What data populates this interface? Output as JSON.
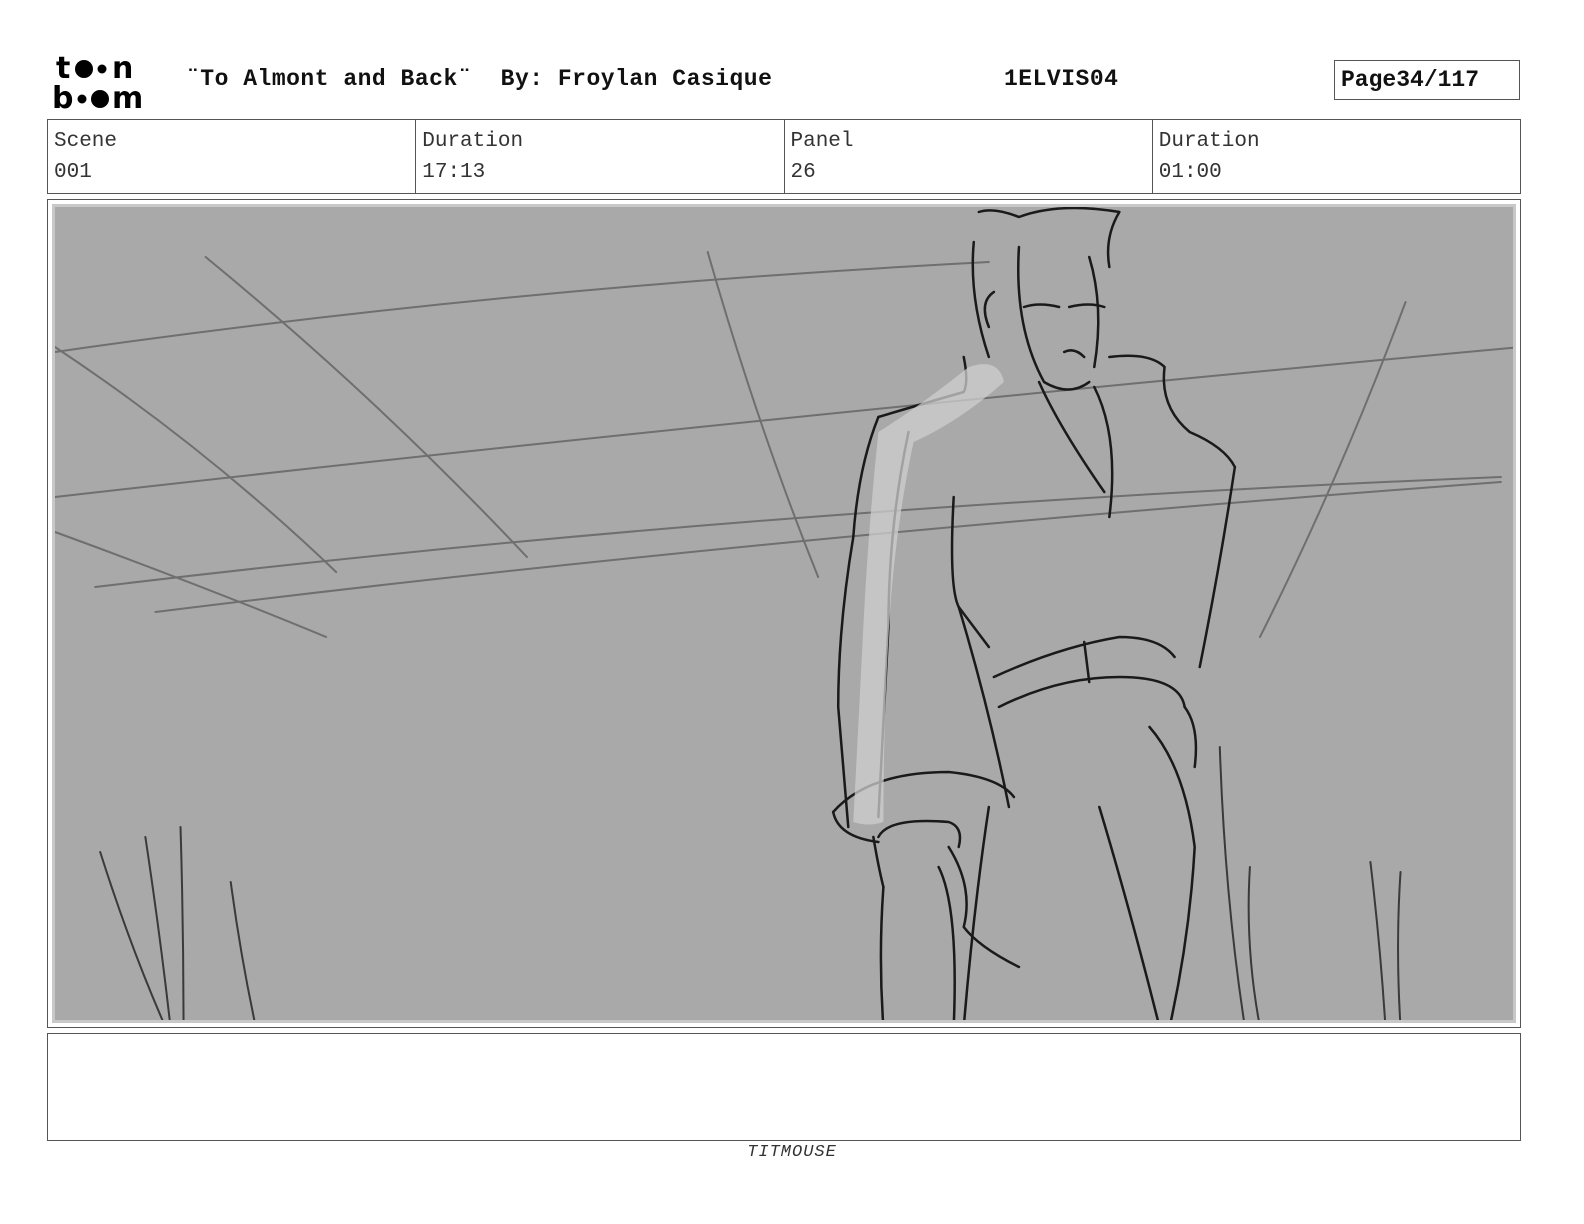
{
  "header": {
    "logo_text": "toon boom",
    "title": "¨To Almont and Back¨  By: Froylan Casique",
    "production_code": "1ELVIS04",
    "page_label": "Page",
    "page_number": "34/117"
  },
  "info": {
    "scene_label": "Scene",
    "scene_value": "001",
    "scene_duration_label": "Duration",
    "scene_duration_value": "17:13",
    "panel_label": "Panel",
    "panel_value": "26",
    "panel_duration_label": "Duration",
    "panel_duration_value": "01:00"
  },
  "panel": {
    "background_color": "#a9a9a9",
    "sketch_color": "#1a1a1a"
  },
  "notes": {
    "text": ""
  },
  "footer": {
    "studio": "TITMOUSE"
  }
}
